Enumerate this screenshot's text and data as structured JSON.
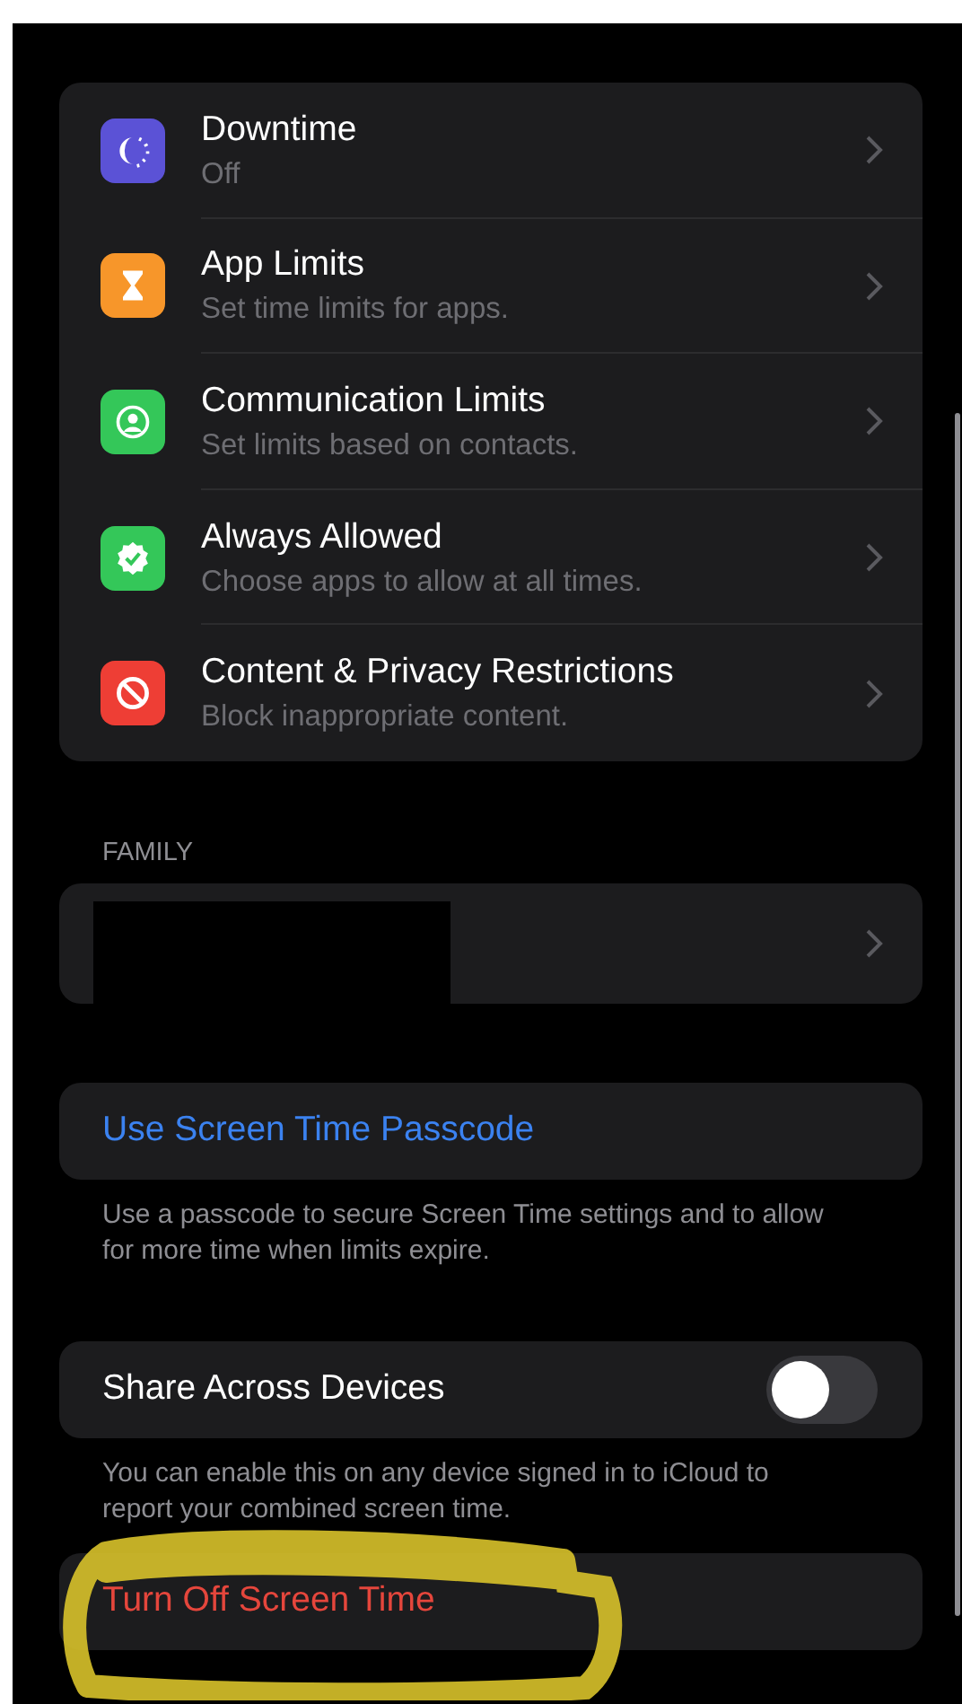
{
  "menu_items": [
    {
      "kind": "downtime",
      "title": "Downtime",
      "subtitle": "Off",
      "color": "#5b52d6"
    },
    {
      "kind": "hourglass",
      "title": "App Limits",
      "subtitle": "Set time limits for apps.",
      "color": "#f7962a"
    },
    {
      "kind": "person",
      "title": "Communication Limits",
      "subtitle": "Set limits based on contacts.",
      "color": "#34c759"
    },
    {
      "kind": "check",
      "title": "Always Allowed",
      "subtitle": "Choose apps to allow at all times.",
      "color": "#34c759"
    },
    {
      "kind": "block",
      "title": "Content & Privacy Restrictions",
      "subtitle": "Block inappropriate content.",
      "color": "#ee3e35"
    }
  ],
  "family": {
    "header": "FAMILY"
  },
  "passcode": {
    "label": "Use Screen Time Passcode",
    "footer": "Use a passcode to secure Screen Time settings and to allow for more time when limits expire."
  },
  "share": {
    "label": "Share Across Devices",
    "on": false,
    "footer": "You can enable this on any device signed in to iCloud to report your combined screen time."
  },
  "turn_off": {
    "label": "Turn Off Screen Time"
  }
}
